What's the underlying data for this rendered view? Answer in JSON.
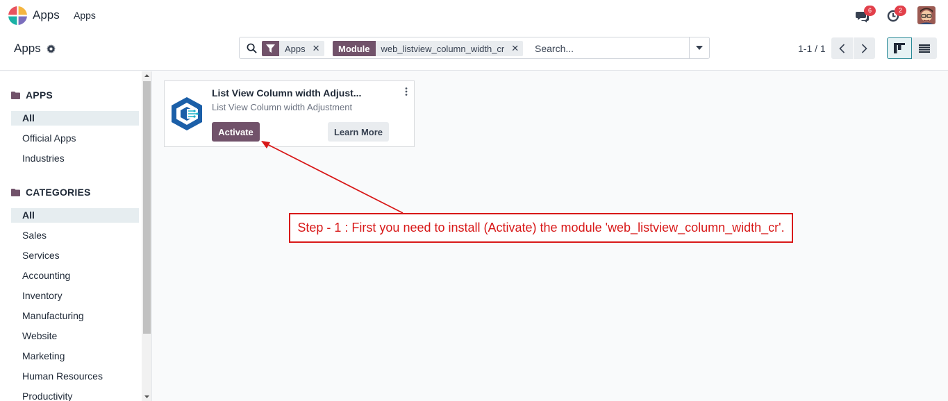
{
  "navbar": {
    "app_name": "Apps",
    "menu_item": "Apps",
    "messages_count": "6",
    "activities_count": "2"
  },
  "control_panel": {
    "breadcrumb": "Apps",
    "search": {
      "facets": [
        {
          "tag_icon": "filter-icon",
          "value": "Apps"
        },
        {
          "tag": "Module",
          "value": "web_listview_column_width_cr"
        }
      ],
      "placeholder": "Search..."
    },
    "pager": "1-1 / 1"
  },
  "sidebar": {
    "apps_heading": "APPS",
    "apps_items": [
      "All",
      "Official Apps",
      "Industries"
    ],
    "categories_heading": "CATEGORIES",
    "category_items": [
      "All",
      "Sales",
      "Services",
      "Accounting",
      "Inventory",
      "Manufacturing",
      "Website",
      "Marketing",
      "Human Resources",
      "Productivity"
    ]
  },
  "card": {
    "title": "List View Column width Adjust...",
    "subtitle": "List View Column width Adjustment",
    "activate_label": "Activate",
    "learn_more_label": "Learn More"
  },
  "annotation": {
    "text": "Step - 1 : First you need to install (Activate) the module 'web_listview_column_width_cr'."
  },
  "colors": {
    "primary": "#71526a",
    "annotation": "#d81818",
    "badge": "#e2404a",
    "selected_bg": "#e6edf0"
  }
}
